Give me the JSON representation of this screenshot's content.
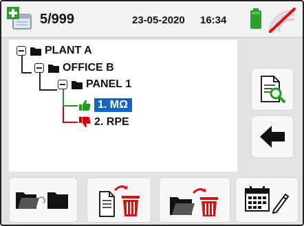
{
  "header": {
    "memory_icon": "sd-memory-icon",
    "counter": "5/999",
    "date": "23-05-2020",
    "time": "16:34",
    "battery_icon": "battery-icon",
    "signal_icon": "no-wireless-icon",
    "battery_color": "#2e9e2e",
    "no_signal_color": "#e01010"
  },
  "tree": {
    "plant": {
      "label": "PLANT A",
      "icon": "folder-icon"
    },
    "office": {
      "label": "OFFICE B",
      "icon": "folder-icon"
    },
    "panel": {
      "label": "PANEL 1",
      "icon": "folder-icon"
    },
    "measurements": [
      {
        "label": "1. MΩ",
        "status": "pass",
        "icon": "thumbs-up-icon",
        "selected": true
      },
      {
        "label": "2. RPE",
        "status": "fail",
        "icon": "thumbs-down-icon",
        "selected": false
      }
    ]
  },
  "side_buttons": [
    {
      "name": "view-measurement-button",
      "icon": "document-search-icon"
    },
    {
      "name": "back-button",
      "icon": "arrow-left-icon"
    }
  ],
  "bottom_buttons": [
    {
      "name": "move-folder-button",
      "icon": "folder-move-icon"
    },
    {
      "name": "delete-measurement-button",
      "icon": "document-delete-icon"
    },
    {
      "name": "delete-folder-button",
      "icon": "folder-delete-icon"
    },
    {
      "name": "edit-calendar-button",
      "icon": "calendar-edit-icon"
    }
  ],
  "colors": {
    "selection": "#1565c0",
    "pass": "#1f9c1f",
    "fail": "#d60000",
    "trash": "#d41414"
  }
}
